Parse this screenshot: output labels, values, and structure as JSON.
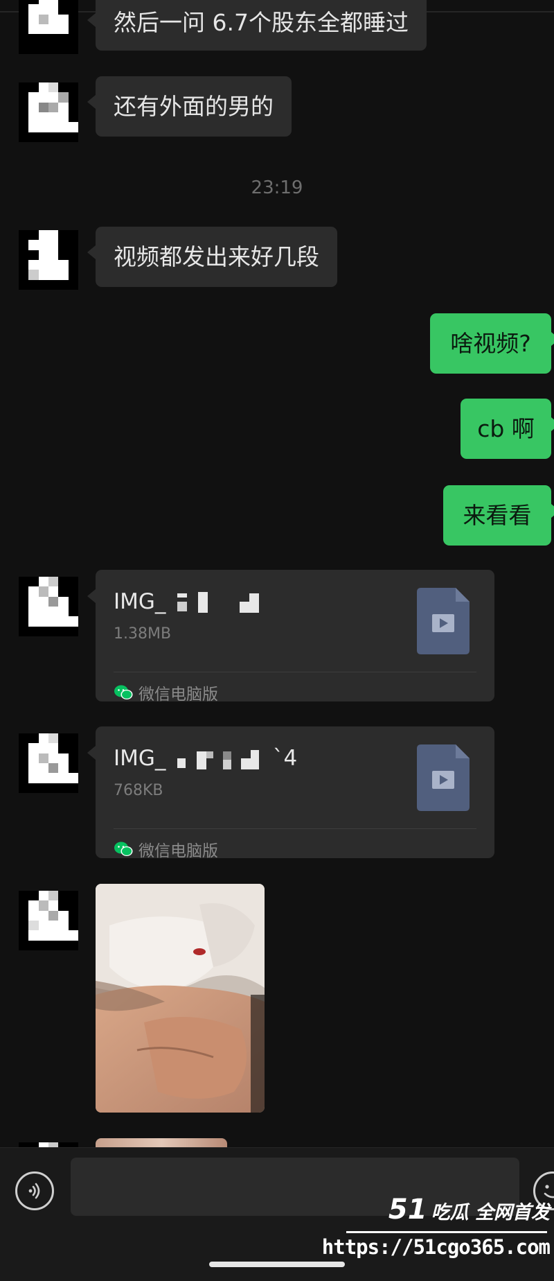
{
  "chat": {
    "messages": [
      {
        "id": "m1",
        "type": "text",
        "direction": "incoming",
        "text": "然后一问 6.7个股东全都睡过"
      },
      {
        "id": "m2",
        "type": "text",
        "direction": "incoming",
        "text": "还有外面的男的"
      },
      {
        "id": "t1",
        "type": "timestamp",
        "text": "23:19"
      },
      {
        "id": "m3",
        "type": "text",
        "direction": "incoming",
        "text": "视频都发出来好几段"
      },
      {
        "id": "m4",
        "type": "text",
        "direction": "outgoing",
        "text": "啥视频?"
      },
      {
        "id": "m5",
        "type": "text",
        "direction": "outgoing",
        "text": "cb 啊"
      },
      {
        "id": "m6",
        "type": "text",
        "direction": "outgoing",
        "text": "来看看"
      },
      {
        "id": "m7",
        "type": "file",
        "direction": "incoming",
        "name_visible": "IMG_",
        "size": "1.38MB",
        "source": "微信电脑版",
        "icon": "video-file-icon"
      },
      {
        "id": "m8",
        "type": "file",
        "direction": "incoming",
        "name_visible": "IMG_",
        "name_suffix": "`4",
        "size": "768KB",
        "source": "微信电脑版",
        "icon": "video-file-icon"
      },
      {
        "id": "m9",
        "type": "image",
        "direction": "incoming",
        "content": "photo"
      }
    ]
  },
  "input_bar": {
    "placeholder": "",
    "value": "",
    "left_icon": "voice-icon",
    "right_icon": "emoji-icon"
  },
  "watermark": {
    "brand_number": "51",
    "brand_text": "吃瓜 全网首发",
    "url": "https://51cgo365.com"
  },
  "colors": {
    "background": "#111111",
    "incoming_bubble": "#2c2c2c",
    "outgoing_bubble": "#38c663",
    "file_icon": "#515f7e",
    "wechat_green": "#07c160"
  }
}
